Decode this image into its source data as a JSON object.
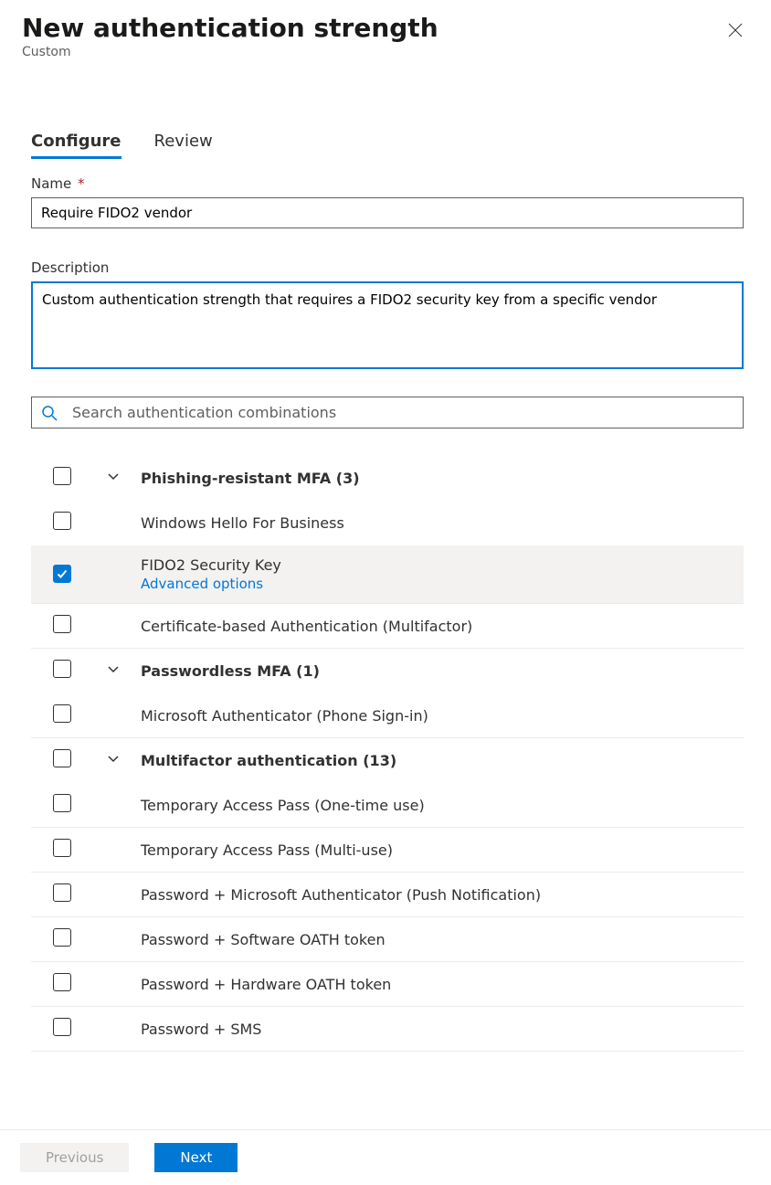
{
  "header": {
    "title": "New authentication strength",
    "subtitle": "Custom"
  },
  "tabs": {
    "configure": "Configure",
    "review": "Review"
  },
  "form": {
    "name_label": "Name",
    "name_value": "Require FIDO2 vendor",
    "description_label": "Description",
    "description_value": "Custom authentication strength that requires a FIDO2 security key from a specific vendor",
    "search_placeholder": "Search authentication combinations"
  },
  "groups": {
    "phishing": {
      "title": "Phishing-resistant MFA (3)",
      "items": {
        "whfb": "Windows Hello For Business",
        "fido2": "FIDO2 Security Key",
        "fido2_adv": "Advanced options",
        "cba": "Certificate-based Authentication (Multifactor)"
      }
    },
    "passwordless": {
      "title": "Passwordless MFA (1)",
      "items": {
        "msauth": "Microsoft Authenticator (Phone Sign-in)"
      }
    },
    "mfa": {
      "title": "Multifactor authentication (13)",
      "items": {
        "tap_one": "Temporary Access Pass (One-time use)",
        "tap_multi": "Temporary Access Pass (Multi-use)",
        "pwd_push": "Password + Microsoft Authenticator (Push Notification)",
        "pwd_soft": "Password + Software OATH token",
        "pwd_hard": "Password + Hardware OATH token",
        "pwd_sms": "Password + SMS"
      }
    }
  },
  "footer": {
    "previous": "Previous",
    "next": "Next"
  }
}
